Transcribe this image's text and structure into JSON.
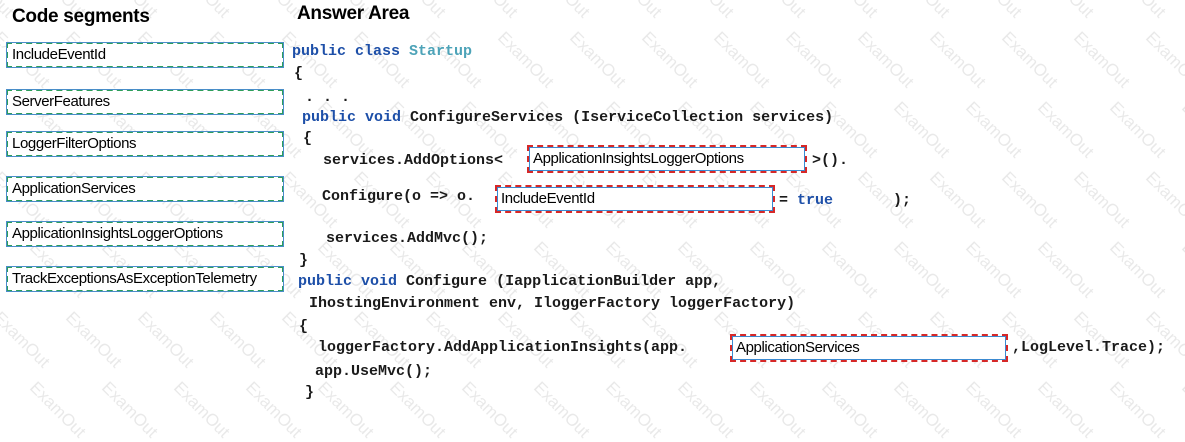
{
  "headings": {
    "segments": "Code segments",
    "answer": "Answer Area"
  },
  "segments": [
    "IncludeEventId",
    "ServerFeatures",
    "LoggerFilterOptions",
    "ApplicationServices",
    "ApplicationInsightsLoggerOptions",
    "TrackExceptionsAsExceptionTelemetry"
  ],
  "code": {
    "l1_kw": "public class",
    "l1_type": "Startup",
    "l2": "{",
    "l3": ". . .",
    "l4_kw": "public void",
    "l4_rest": "ConfigureServices (IserviceCollection services)",
    "l5": "{",
    "l6_pre": "services.AddOptions<",
    "l6_post": ">().",
    "l7_pre": "Configure(o => o.",
    "l7_eq": "= ",
    "l7_val": "true",
    "l7_post": ");",
    "l8": "services.AddMvc();",
    "l9": "}",
    "l10_kw": "public void",
    "l10_rest": "Configure (IapplicationBuilder app,",
    "l11": "IhostingEnvironment env, IloggerFactory loggerFactory)",
    "l12": "{",
    "l13_pre": "loggerFactory.AddApplicationInsights(app.",
    "l13_post": ",LogLevel.Trace);",
    "l14": "app.UseMvc();",
    "l15": "}"
  },
  "slots": {
    "slot1": "ApplicationInsightsLoggerOptions",
    "slot2": "IncludeEventId",
    "slot3": "ApplicationServices"
  },
  "watermark": "ExamOut"
}
